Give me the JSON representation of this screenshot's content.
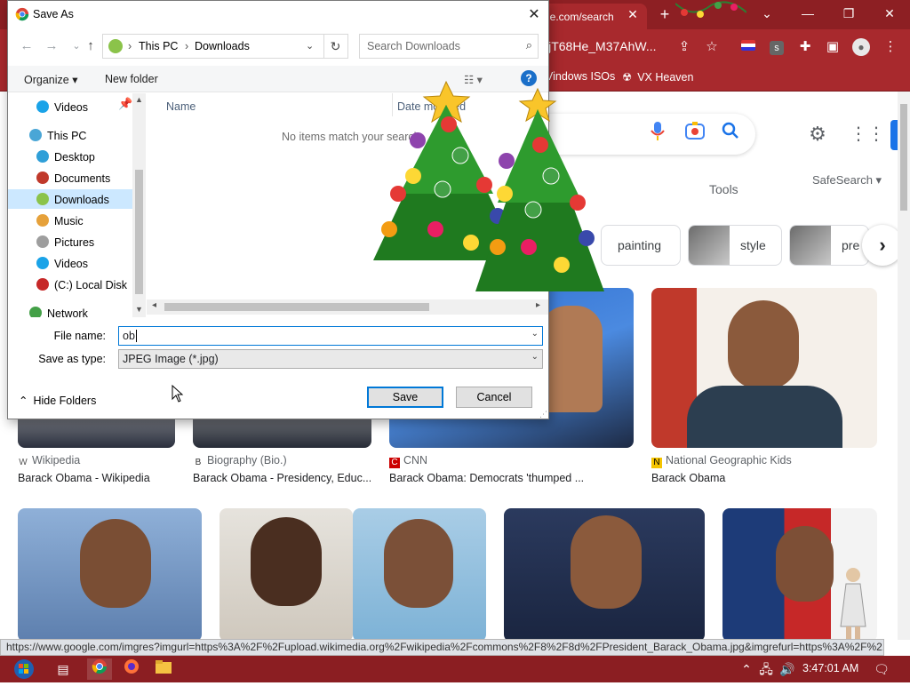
{
  "browser": {
    "tab_title": "le.com/search",
    "omnibox_text": "cwjT68He_M37AhW...",
    "bookmarks": [
      {
        "label": "Vindows ISOs"
      },
      {
        "label": "VX Heaven"
      }
    ],
    "status_url": "https://www.google.com/imgres?imgurl=https%3A%2F%2Fupload.wikimedia.org%2Fwikipedia%2Fcommons%2F8%2F8d%2FPresident_Barack_Obama.jpg&imgrefurl=https%3A%2F%2..."
  },
  "google": {
    "tools_label": "Tools",
    "safesearch_label": "SafeSearch",
    "chips": [
      {
        "label": "painting"
      },
      {
        "label": "style"
      },
      {
        "label": "pre"
      }
    ],
    "results": [
      {
        "source": "Wikipedia",
        "title": "Barack Obama - Wikipedia",
        "favicon": "W"
      },
      {
        "source": "Biography (Bio.)",
        "title": "Barack Obama - Presidency, Educ...",
        "favicon": "B"
      },
      {
        "source": "CNN",
        "title": "Barack Obama: Democrats 'thumped ...",
        "favicon": "C"
      },
      {
        "source": "National Geographic Kids",
        "title": "Barack Obama",
        "favicon": "N"
      }
    ]
  },
  "taskbar": {
    "time": "3:47:01 AM"
  },
  "dialog": {
    "title": "Save As",
    "breadcrumb": [
      "This PC",
      "Downloads"
    ],
    "search_placeholder": "Search Downloads",
    "organize_label": "Organize",
    "new_folder_label": "New folder",
    "help_glyph": "?",
    "nav_tree": [
      {
        "label": "Videos",
        "icon": "videos-icon",
        "color": "#1aa3e8",
        "indent": 1,
        "selected": false
      },
      {
        "label": "This PC",
        "icon": "computer-icon",
        "color": "#4aa6d6",
        "indent": 0,
        "selected": false
      },
      {
        "label": "Desktop",
        "icon": "desktop-icon",
        "color": "#2f9fd8",
        "indent": 1,
        "selected": false
      },
      {
        "label": "Documents",
        "icon": "documents-icon",
        "color": "#c0392b",
        "indent": 1,
        "selected": false
      },
      {
        "label": "Downloads",
        "icon": "downloads-icon",
        "color": "#8bc34a",
        "indent": 1,
        "selected": true
      },
      {
        "label": "Music",
        "icon": "music-icon",
        "color": "#e6a13a",
        "indent": 1,
        "selected": false
      },
      {
        "label": "Pictures",
        "icon": "pictures-icon",
        "color": "#9e9e9e",
        "indent": 1,
        "selected": false
      },
      {
        "label": "Videos",
        "icon": "videos-icon",
        "color": "#1aa3e8",
        "indent": 1,
        "selected": false
      },
      {
        "label": "(C:) Local Disk",
        "icon": "disk-icon",
        "color": "#c62828",
        "indent": 1,
        "selected": false
      },
      {
        "label": "Network",
        "icon": "network-icon",
        "color": "#43a047",
        "indent": 0,
        "selected": false
      }
    ],
    "columns": [
      "Name",
      "Date modified"
    ],
    "empty_message": "No items match your search.",
    "file_name_label": "File name:",
    "file_name_value": "ob",
    "save_type_label": "Save as type:",
    "save_type_value": "JPEG Image (*.jpg)",
    "hide_folders_label": "Hide Folders",
    "save_label": "Save",
    "cancel_label": "Cancel"
  }
}
